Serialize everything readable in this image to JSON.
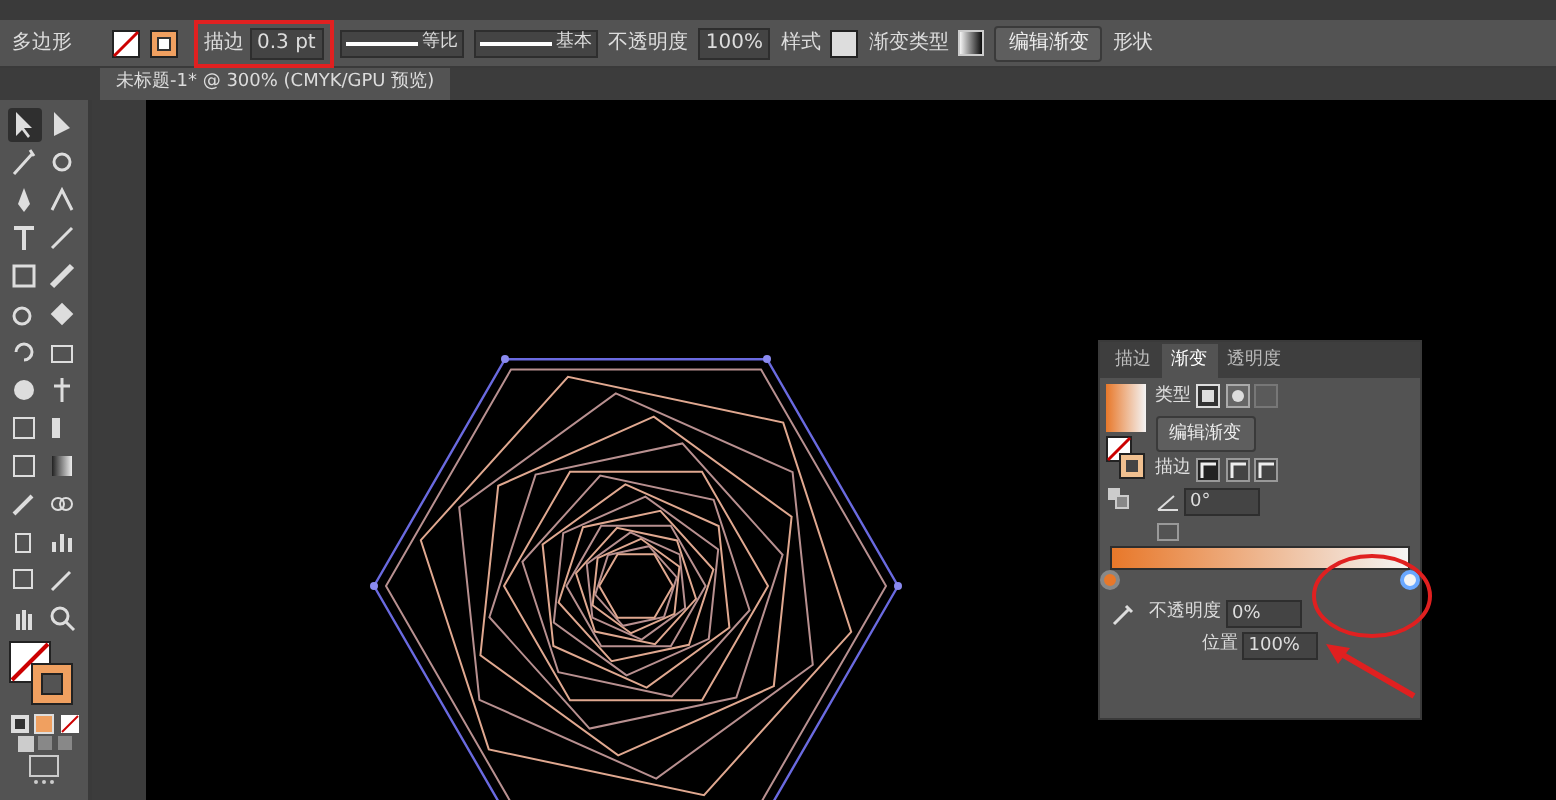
{
  "control_bar": {
    "object_label": "多边形",
    "stroke_label": "描边",
    "stroke_weight": "0.3 pt",
    "stroke_highlighted": true,
    "profile_label": "等比",
    "brush_label": "基本",
    "opacity_label": "不透明度",
    "opacity_value": "100%",
    "style_label": "样式",
    "gradient_type_label": "渐变类型",
    "edit_gradient_button": "编辑渐变",
    "shape_label": "形状"
  },
  "document_tab": {
    "title": "未标题-1* @ 300% (CMYK/GPU 预览)"
  },
  "tools": [
    {
      "selected": true
    },
    {
      "selected": false
    },
    {
      "selected": false
    },
    {
      "selected": false
    },
    {
      "selected": false
    },
    {
      "selected": false
    },
    {
      "selected": false
    },
    {
      "selected": false
    },
    {
      "selected": false
    },
    {
      "selected": false
    },
    {
      "selected": false
    },
    {
      "selected": false
    },
    {
      "selected": false
    },
    {
      "selected": false
    },
    {
      "selected": false
    },
    {
      "selected": false
    },
    {
      "selected": false
    },
    {
      "selected": false
    },
    {
      "selected": false
    },
    {
      "selected": false
    },
    {
      "selected": false
    },
    {
      "selected": false
    },
    {
      "selected": false
    },
    {
      "selected": false
    },
    {
      "selected": false
    },
    {
      "selected": false
    },
    {
      "selected": false
    },
    {
      "selected": false
    }
  ],
  "gradient_panel": {
    "tabs": [
      {
        "label": "描边",
        "selected": false
      },
      {
        "label": "渐变",
        "selected": true
      },
      {
        "label": "透明度",
        "selected": false
      }
    ],
    "type_label": "类型",
    "edit_gradient_button": "编辑渐变",
    "stroke_label": "描边",
    "angle_value": "0°",
    "stops": [
      {
        "color": "#e8782a",
        "selected": false
      },
      {
        "color": "#f4f4f4",
        "selected": true
      }
    ],
    "opacity_label": "不透明度",
    "opacity_value": "0%",
    "location_label": "位置",
    "location_value": "100%"
  }
}
